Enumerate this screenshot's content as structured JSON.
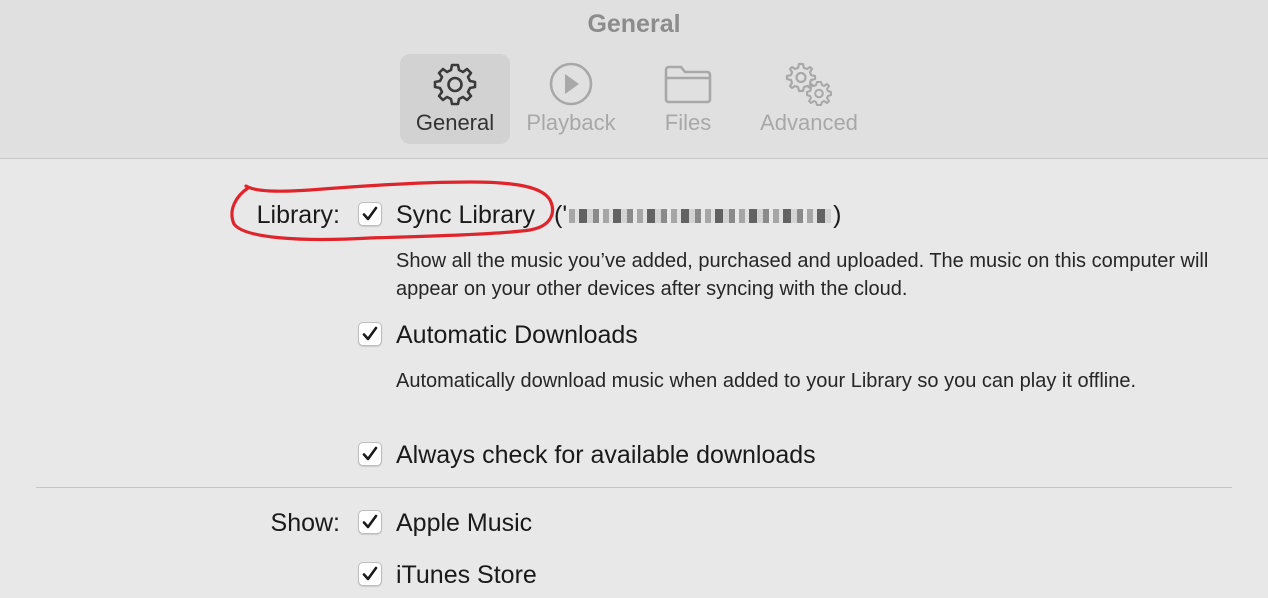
{
  "window": {
    "title": "General"
  },
  "tabs": [
    {
      "label": "General",
      "icon": "gear-icon",
      "selected": true
    },
    {
      "label": "Playback",
      "icon": "play-icon",
      "selected": false
    },
    {
      "label": "Files",
      "icon": "folder-icon",
      "selected": false
    },
    {
      "label": "Advanced",
      "icon": "gears-icon",
      "selected": false
    }
  ],
  "library": {
    "label": "Library:",
    "sync": {
      "label": "Sync Library",
      "checked": true,
      "account_open": "('",
      "account_close": ")",
      "description": "Show all the music you’ve added, purchased and uploaded. The music on this computer will appear on your other devices after syncing with the cloud."
    },
    "auto_downloads": {
      "label": "Automatic Downloads",
      "checked": true,
      "description": "Automatically download music when added to your Library so you can play it offline."
    },
    "check_downloads": {
      "label": "Always check for available downloads",
      "checked": true
    }
  },
  "show": {
    "label": "Show:",
    "items": [
      {
        "label": "Apple Music",
        "checked": true
      },
      {
        "label": "iTunes Store",
        "checked": true
      }
    ]
  },
  "colors": {
    "annotation": "#e0242b",
    "window_bg": "#e8e8e8",
    "toolbar_bg": "#e0e0e0",
    "selected_tab_bg": "#d2d2d2"
  }
}
